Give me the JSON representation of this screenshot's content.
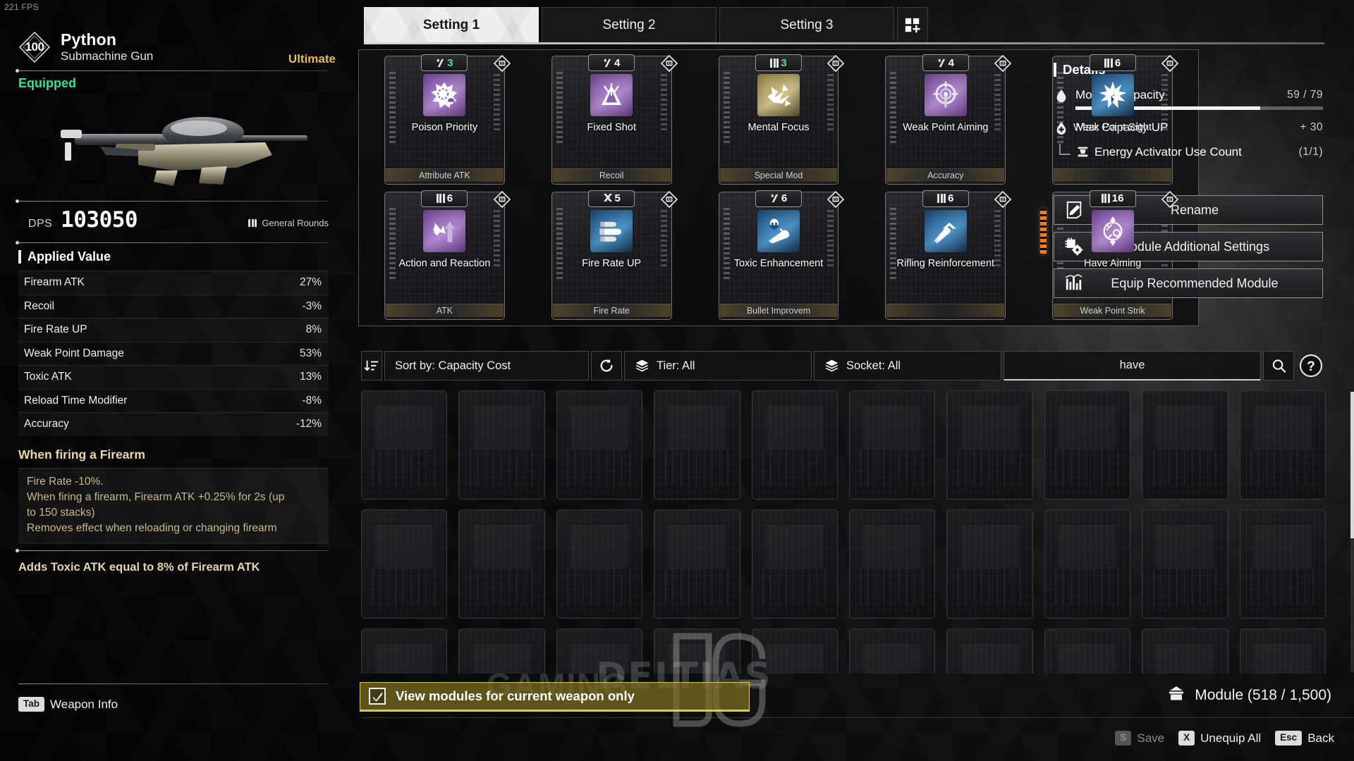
{
  "hud": {
    "fps": "221 FPS"
  },
  "weapon": {
    "level": "100",
    "name": "Python",
    "type": "Submachine Gun",
    "rarity": "Ultimate",
    "status": "Equipped",
    "dps_label": "DPS",
    "dps_value": "103050",
    "ammo_type": "General Rounds"
  },
  "applied_value": {
    "title": "Applied Value",
    "stats": [
      {
        "name": "Firearm ATK",
        "value": "27%"
      },
      {
        "name": "Recoil",
        "value": "-3%"
      },
      {
        "name": "Fire Rate UP",
        "value": "8%"
      },
      {
        "name": "Weak Point Damage",
        "value": "53%"
      },
      {
        "name": "Toxic ATK",
        "value": "13%"
      },
      {
        "name": "Reload Time Modifier",
        "value": "-8%"
      },
      {
        "name": "Accuracy",
        "value": "-12%"
      }
    ]
  },
  "effect": {
    "title": "When firing a Firearm",
    "lines": [
      "Fire Rate -10%.",
      "When firing a firearm, Firearm ATK +0.25% for 2s (up",
      "to 150 stacks)",
      "Removes effect when reloading or changing firearm"
    ],
    "extra": "Adds Toxic ATK equal to 8% of Firearm ATK"
  },
  "left_hint": {
    "key": "Tab",
    "label": "Weapon Info"
  },
  "tabs": {
    "items": [
      {
        "label": "Setting 1",
        "active": true
      },
      {
        "label": "Setting 2",
        "active": false
      },
      {
        "label": "Setting 3",
        "active": false
      }
    ],
    "add_icon": "add-setting-icon"
  },
  "equipped_modules": [
    {
      "name": "Poison Priority",
      "tag": "Attribute ATK",
      "cost": "3",
      "cost_green": true,
      "shape": "slash",
      "color": "purple",
      "icon": "poison-burst-icon",
      "energy": false
    },
    {
      "name": "Fixed Shot",
      "tag": "Recoil",
      "cost": "4",
      "cost_green": false,
      "shape": "slash",
      "color": "purple",
      "icon": "recoil-triangle-icon",
      "energy": false
    },
    {
      "name": "Mental Focus",
      "tag": "Special Mod",
      "cost": "3",
      "cost_green": true,
      "shape": "bars",
      "color": "gold",
      "icon": "arrows-burst-icon",
      "energy": false
    },
    {
      "name": "Weak Point Aiming",
      "tag": "Accuracy",
      "cost": "4",
      "cost_green": false,
      "shape": "slash",
      "color": "purple",
      "icon": "crosshair-ring-icon",
      "energy": false
    },
    {
      "name": "Weak Point Sight",
      "tag": "",
      "cost": "6",
      "cost_green": false,
      "shape": "bars",
      "color": "blue",
      "icon": "star-burst-icon",
      "energy": false
    },
    {
      "name": "Action and Reaction",
      "tag": "ATK",
      "cost": "6",
      "cost_green": false,
      "shape": "bars",
      "color": "purple",
      "icon": "up-down-arrow-icon",
      "energy": false
    },
    {
      "name": "Fire Rate UP",
      "tag": "Fire Rate",
      "cost": "5",
      "cost_green": false,
      "shape": "x",
      "color": "blue",
      "icon": "bullets-icon",
      "energy": false
    },
    {
      "name": "Toxic Enhancement",
      "tag": "Bullet Improvem",
      "cost": "6",
      "cost_green": false,
      "shape": "slash",
      "color": "blue",
      "icon": "toxic-bullet-icon",
      "energy": false
    },
    {
      "name": "Rifling Reinforcement",
      "tag": "",
      "cost": "6",
      "cost_green": false,
      "shape": "bars",
      "color": "blue",
      "icon": "bullet-up-icon",
      "energy": false
    },
    {
      "name": "Have Aiming",
      "tag": "Weak Point Strik",
      "cost": "16",
      "cost_green": false,
      "shape": "bars",
      "color": "purple",
      "icon": "aim-expand-icon",
      "energy": true
    }
  ],
  "details": {
    "title": "Details",
    "capacity": {
      "label": "Module Capacity",
      "value": "59 / 79",
      "used": 59,
      "max": 79,
      "icon": "droplet-icon"
    },
    "max_capacity_up": {
      "label": "Max Capacity UP",
      "value": "+ 30",
      "icon": "droplet-plus-icon"
    },
    "activator": {
      "label": "Energy Activator Use Count",
      "value": "(1/1)",
      "icon": "activator-icon"
    }
  },
  "actions": [
    {
      "label": "Rename",
      "icon": "pencil-note-icon"
    },
    {
      "label": "Module Additional Settings",
      "icon": "chip-gear-icon"
    },
    {
      "label": "Equip Recommended Module",
      "icon": "bar-chart-icon"
    }
  ],
  "filters": {
    "sort_icon": "sort-descending-icon",
    "sort_label": "Sort by: Capacity Cost",
    "reset_icon": "reset-icon",
    "tier_icon": "layers-icon",
    "tier_label": "Tier: All",
    "socket_icon": "layers-icon",
    "socket_label": "Socket: All",
    "search_value": "have",
    "search_icon": "magnifier-icon",
    "help_icon": "question-icon"
  },
  "inventory": {
    "slot_count": 30,
    "empty_label": ""
  },
  "watermark": {
    "line1": "DELTIAS",
    "line2": "GAMING",
    "logo": "DG"
  },
  "bottom": {
    "checkbox": {
      "label": "View modules for current weapon only",
      "checked": true
    },
    "module_count": {
      "label": "Module (518 / 1,500)",
      "icon": "box-icon"
    }
  },
  "keys": [
    {
      "key": "S",
      "label": "Save",
      "dim": true
    },
    {
      "key": "X",
      "label": "Unequip All",
      "dim": false
    },
    {
      "key": "Esc",
      "label": "Back",
      "dim": false
    }
  ]
}
